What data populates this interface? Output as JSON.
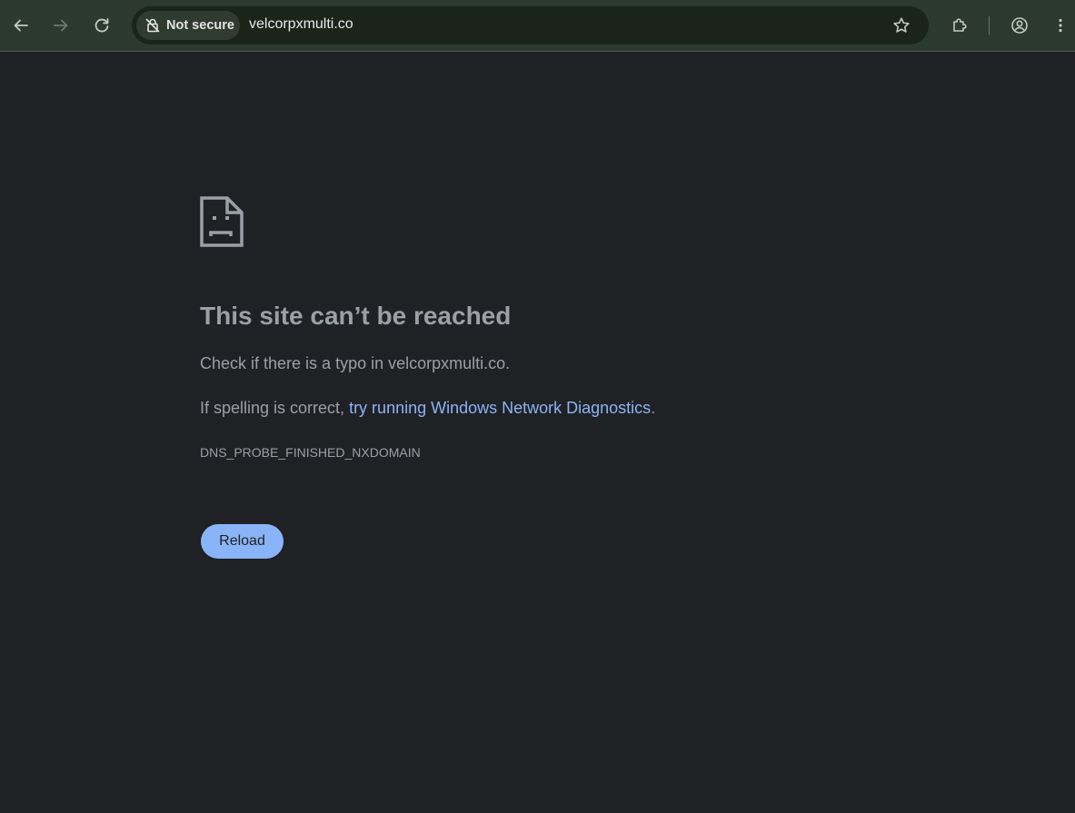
{
  "browser": {
    "security_chip_label": "Not secure",
    "url": "velcorpxmulti.co"
  },
  "icons": {
    "back": "arrow-left-icon",
    "forward": "arrow-right-icon",
    "reload": "reload-icon",
    "security": "not-secure-icon",
    "bookmark": "star-icon",
    "extensions": "puzzle-icon",
    "profile": "account-circle-icon",
    "menu": "more-vert-icon",
    "error": "sad-page-icon"
  },
  "error_page": {
    "heading": "This site can’t be reached",
    "typo_text": "Check if there is a typo in velcorpxmulti.co.",
    "spelling_prefix": "If spelling is correct, ",
    "diagnostics_link": "try running Windows Network Diagnostics",
    "spelling_suffix": ".",
    "error_code": "DNS_PROBE_FINISHED_NXDOMAIN",
    "reload_label": "Reload"
  },
  "colors": {
    "page_background": "#202124",
    "toolbar_background": "#2b3a2c",
    "link": "#8ab4f8",
    "button": "#8ab4f8",
    "text": "#9aa0a6"
  }
}
